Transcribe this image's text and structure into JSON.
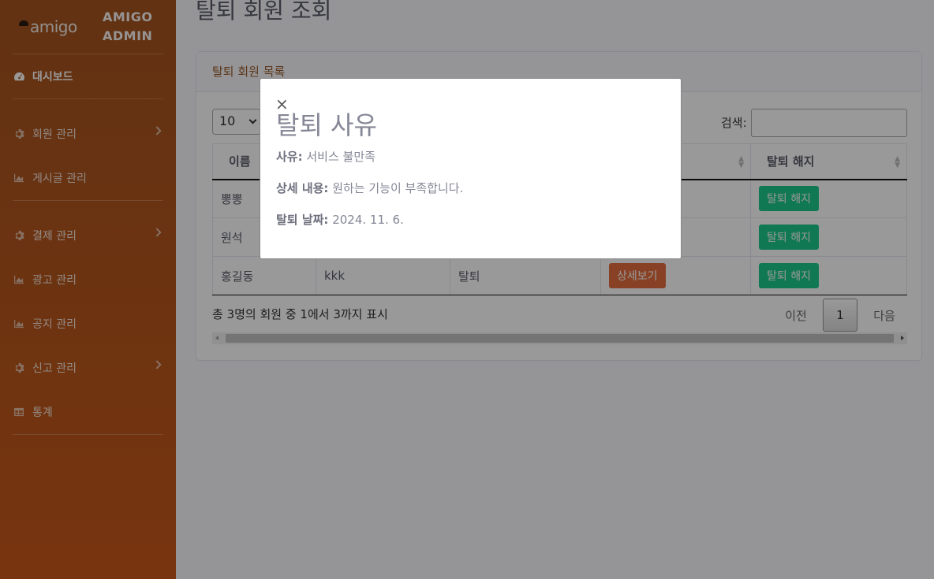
{
  "sidebar": {
    "logo_text": "amigo",
    "brand_line1": "AMIGO",
    "brand_line2": "ADMIN",
    "items": [
      {
        "label": "대시보드",
        "icon": "tachometer-icon"
      },
      {
        "label": "회원 관리",
        "icon": "cog-icon"
      },
      {
        "label": "게시글 관리",
        "icon": "chart-area-icon"
      },
      {
        "label": "결제 관리",
        "icon": "cog-icon"
      },
      {
        "label": "광고 관리",
        "icon": "chart-area-icon"
      },
      {
        "label": "공지 관리",
        "icon": "chart-area-icon"
      },
      {
        "label": "신고 관리",
        "icon": "cog-icon"
      },
      {
        "label": "통계",
        "icon": "table-icon"
      }
    ]
  },
  "page": {
    "title": "탈퇴 회원 조회",
    "card_title": "탈퇴 회원 목록",
    "page_length": "10",
    "search_label": "검색:",
    "columns": [
      "이름",
      "",
      "",
      "",
      "탈퇴 해지"
    ],
    "rows": [
      {
        "name": "뽕뽕",
        "col2": "",
        "col3": "",
        "action": "",
        "restore": "탈퇴 해지"
      },
      {
        "name": "원석",
        "col2": "",
        "col3": "",
        "action": "",
        "restore": "탈퇴 해지"
      },
      {
        "name": "홍길동",
        "col2": "kkk",
        "col3": "탈퇴",
        "action": "상세보기",
        "restore": "탈퇴 해지"
      }
    ],
    "info": "총 3명의 회원 중 1에서 3까지 표시",
    "pager": {
      "prev": "이전",
      "current": "1",
      "next": "다음"
    }
  },
  "modal": {
    "close": "×",
    "title": "탈퇴 사유",
    "reason_label": "사유:",
    "reason_value": " 서비스 불만족",
    "detail_label": "상세 내용:",
    "detail_value": " 원하는 기능이 부족합니다.",
    "date_label": "탈퇴 날짜:",
    "date_value": " 2024. 11. 6."
  },
  "colors": {
    "sidebar_top": "#a35420",
    "sidebar_bottom": "#c8581a",
    "success": "#1cc88a",
    "detail_button": "#e36d3c"
  }
}
